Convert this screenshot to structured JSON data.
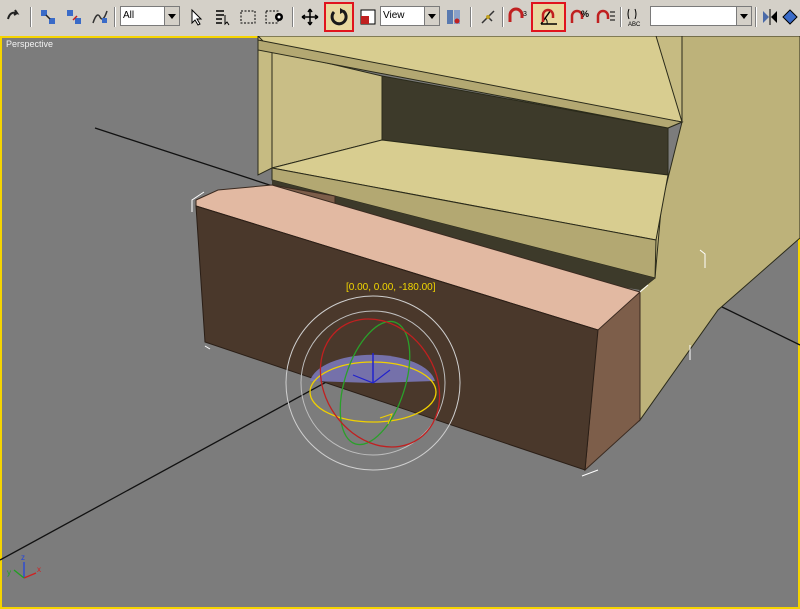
{
  "toolbar": {
    "selection_filter": "All",
    "reference_coord": "View",
    "named_selection": ""
  },
  "viewport": {
    "label": "Perspective",
    "transform_readout": "[0.00, 0.00, -180.00]",
    "axis_x": "x",
    "axis_y": "y",
    "axis_z": "z"
  },
  "colors": {
    "highlight": "#e0141e",
    "active_border": "#f5d400",
    "shelf_face": "#d7cc8b",
    "drawer_front": "#4a382b"
  },
  "icons": [
    "undo-icon",
    "select-link-icon",
    "unlink-icon",
    "bind-space-warp-icon",
    "select-object-icon",
    "select-by-name-icon",
    "rect-selection-icon",
    "window-crossing-icon",
    "move-icon",
    "rotate-icon",
    "scale-icon",
    "pivot-center-icon",
    "manipulate-icon",
    "snap-3d-icon",
    "angle-snap-icon",
    "percent-snap-icon",
    "spinner-snap-icon",
    "edit-named-selection-icon",
    "mirror-icon",
    "align-icon"
  ]
}
